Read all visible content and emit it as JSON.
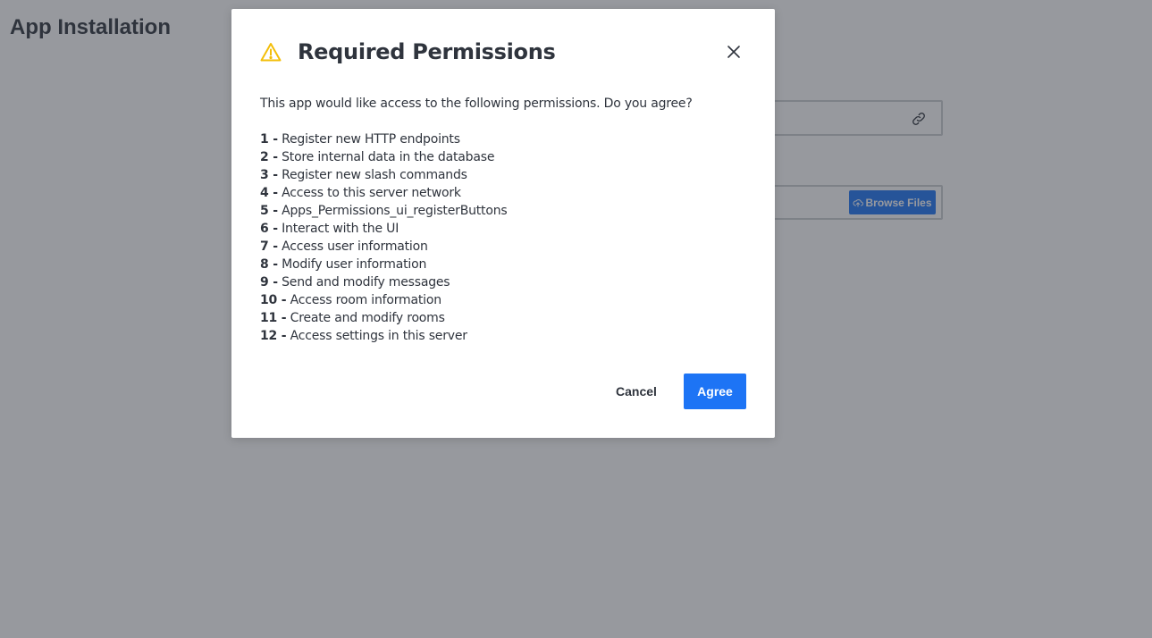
{
  "page": {
    "title": "App Installation"
  },
  "background": {
    "url_field_icon": "link-icon",
    "browse_button_label": "Browse Files",
    "browse_button_icon": "cloud-upload-icon"
  },
  "modal": {
    "title": "Required Permissions",
    "title_icon": "warning-icon",
    "close_icon": "close-icon",
    "intro": "This app would like access to the following permissions. Do you agree?",
    "permissions": [
      {
        "num": "1 -",
        "label": "Register new HTTP endpoints"
      },
      {
        "num": "2 -",
        "label": "Store internal data in the database"
      },
      {
        "num": "3 -",
        "label": "Register new slash commands"
      },
      {
        "num": "4 -",
        "label": "Access to this server network"
      },
      {
        "num": "5 -",
        "label": "Apps_Permissions_ui_registerButtons"
      },
      {
        "num": "6 -",
        "label": "Interact with the UI"
      },
      {
        "num": "7 -",
        "label": "Access user information"
      },
      {
        "num": "8 -",
        "label": "Modify user information"
      },
      {
        "num": "9 -",
        "label": "Send and modify messages"
      },
      {
        "num": "10 -",
        "label": "Access room information"
      },
      {
        "num": "11 -",
        "label": "Create and modify rooms"
      },
      {
        "num": "12 -",
        "label": "Access settings in this server"
      }
    ],
    "cancel_label": "Cancel",
    "agree_label": "Agree"
  },
  "colors": {
    "primary": "#1d74f5",
    "text": "#2f343d",
    "warning": "#f3be08",
    "overlay": "rgba(47, 52, 61, 0.5)"
  }
}
